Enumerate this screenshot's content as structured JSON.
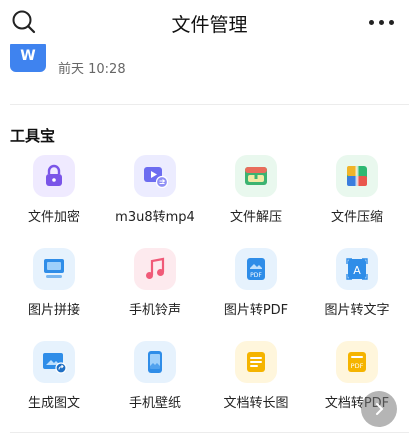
{
  "header": {
    "title": "文件管理",
    "search_icon": "search-icon",
    "more_icon": "more-icon"
  },
  "recent_file": {
    "icon_text": "W",
    "time": "前天 10:28"
  },
  "toolbox": {
    "title": "工具宝",
    "items": [
      {
        "label": "文件加密",
        "icon": "lock-icon",
        "color": "#7a55e8",
        "bg": "#efeaff"
      },
      {
        "label": "m3u8转mp4",
        "icon": "video-convert-icon",
        "color": "#6c6cf0",
        "bg": "#ececff"
      },
      {
        "label": "文件解压",
        "icon": "unzip-icon",
        "color": "#3cb371",
        "bg": "#e9f8ee"
      },
      {
        "label": "文件压缩",
        "icon": "compress-icon",
        "color": "#2eb872",
        "bg": "#e9f8ee"
      },
      {
        "label": "图片拼接",
        "icon": "image-stitch-icon",
        "color": "#2f8de8",
        "bg": "#e6f2fd"
      },
      {
        "label": "手机铃声",
        "icon": "music-note-icon",
        "color": "#f05a78",
        "bg": "#fdeaee"
      },
      {
        "label": "图片转PDF",
        "icon": "image-pdf-icon",
        "color": "#2f8de8",
        "bg": "#e6f2fd"
      },
      {
        "label": "图片转文字",
        "icon": "image-text-icon",
        "color": "#2f8de8",
        "bg": "#e6f2fd"
      },
      {
        "label": "生成图文",
        "icon": "image-share-icon",
        "color": "#2f8de8",
        "bg": "#e6f2fd"
      },
      {
        "label": "手机壁纸",
        "icon": "phone-wallpaper-icon",
        "color": "#2f8de8",
        "bg": "#e6f2fd"
      },
      {
        "label": "文档转长图",
        "icon": "doc-longimage-icon",
        "color": "#f5b400",
        "bg": "#fff6dc"
      },
      {
        "label": "文档转PDF",
        "icon": "doc-pdf-icon",
        "color": "#f5b400",
        "bg": "#fff6dc"
      }
    ]
  },
  "scroll_button_icon": "chevron-right-icon"
}
